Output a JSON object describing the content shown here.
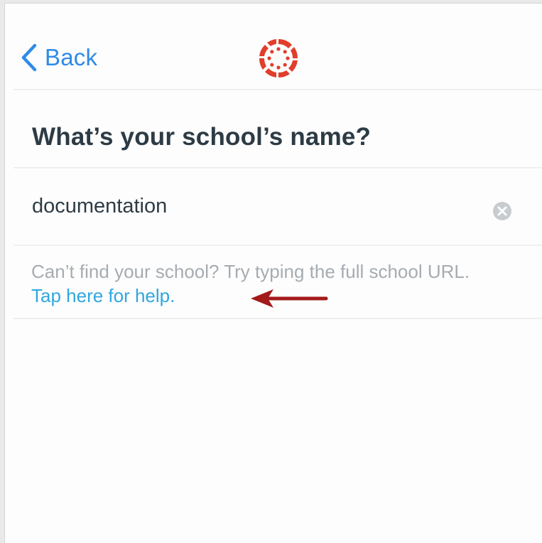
{
  "nav": {
    "back_label": "Back",
    "logo_icon": "canvas-logo-icon",
    "accent_color": "#2f8be6",
    "brand_color": "#e13e2b"
  },
  "main": {
    "title": "What’s your school’s name?",
    "search": {
      "value": "documentation",
      "placeholder": "",
      "clear_icon": "clear-circle-icon"
    },
    "help": {
      "text": "Can’t find your school? Try typing the full school URL. ",
      "link_text": "Tap here for help.",
      "link_color": "#2fa7de",
      "annotation_icon": "red-arrow-icon",
      "annotation_color": "#a31a1a"
    }
  }
}
